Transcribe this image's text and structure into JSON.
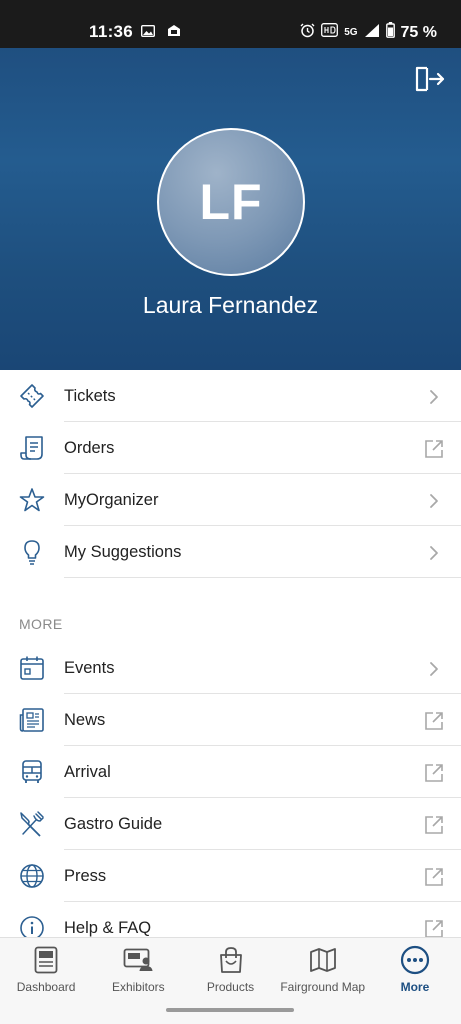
{
  "status_bar": {
    "time": "11:36",
    "network": "5G",
    "battery": "75 %"
  },
  "profile": {
    "initials": "LF",
    "name": "Laura Fernandez"
  },
  "colors": {
    "brand_dark": "#1d4f82",
    "icon_blue": "#2c5f91",
    "trail_gray": "#a8a8a8"
  },
  "menu": [
    {
      "label": "Tickets",
      "icon": "ticket-icon",
      "trail": "chevron"
    },
    {
      "label": "Orders",
      "icon": "receipt-icon",
      "trail": "external"
    },
    {
      "label": "MyOrganizer",
      "icon": "star-icon",
      "trail": "chevron"
    },
    {
      "label": "My Suggestions",
      "icon": "lightbulb-icon",
      "trail": "chevron"
    }
  ],
  "more": {
    "title": "MORE",
    "items": [
      {
        "label": "Events",
        "icon": "calendar-icon",
        "trail": "chevron"
      },
      {
        "label": "News",
        "icon": "newspaper-icon",
        "trail": "external"
      },
      {
        "label": "Arrival",
        "icon": "bus-icon",
        "trail": "external"
      },
      {
        "label": "Gastro Guide",
        "icon": "cutlery-icon",
        "trail": "external"
      },
      {
        "label": "Press",
        "icon": "globe-icon",
        "trail": "external"
      },
      {
        "label": "Help & FAQ",
        "icon": "info-icon",
        "trail": "external"
      }
    ]
  },
  "bottom_nav": [
    {
      "label": "Dashboard",
      "icon": "dashboard-icon",
      "active": false
    },
    {
      "label": "Exhibitors",
      "icon": "exhibitors-icon",
      "active": false
    },
    {
      "label": "Products",
      "icon": "shopping-bag-icon",
      "active": false
    },
    {
      "label": "Fairground Map",
      "icon": "map-icon",
      "active": false
    },
    {
      "label": "More",
      "icon": "more-icon",
      "active": true
    }
  ]
}
